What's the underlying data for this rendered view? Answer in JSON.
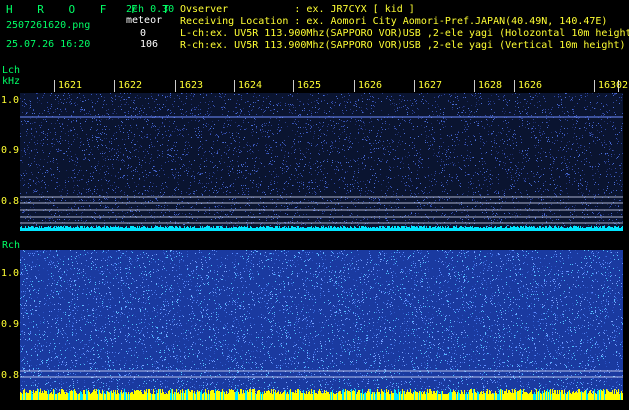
{
  "header": {
    "app_title": "H R O F F T",
    "version": "2ch 0.30",
    "filename": "2507261620.png",
    "mode_label": "meteor",
    "count_top": "0",
    "datetime": "25.07.26 16:20",
    "count_bottom": "106",
    "observer_line": "Ovserver           : ex. JR7CYX [ kid ]",
    "location_line": "Receiving Location : ex. Aomori City Aomori-Pref.JAPAN(40.49N, 140.47E)",
    "lch_line": "L-ch:ex. UV5R 113.900Mhz(SAPPORO VOR)USB ,2-ele yagi (Holozontal 10m height",
    "rch_line": "R-ch:ex. UV5R 113.900Mhz(SAPPORO VOR)USB ,2-ele yagi (Vertical 10m height)"
  },
  "top_panel": {
    "label": "Lch",
    "unit": "kHz",
    "y_ticks": [
      "1.0",
      "0.9",
      "0.8"
    ]
  },
  "bottom_panel": {
    "label": "Rch",
    "y_ticks": [
      "1.0",
      "0.9",
      "0.8"
    ]
  },
  "time_ticks": [
    "1621",
    "1622",
    "1623",
    "1624",
    "1625",
    "1626",
    "1627",
    "1628",
    "1626",
    "1630",
    "2"
  ],
  "colors": {
    "bg": "#000000",
    "green_text": "#00ff66",
    "yellow_text": "#ffff33",
    "waterfall_top": "#0d1838",
    "waterfall_bottom": "#1a3aa0",
    "signal_cyan": "#00e5ff",
    "signal_yellow": "#ffff00"
  }
}
